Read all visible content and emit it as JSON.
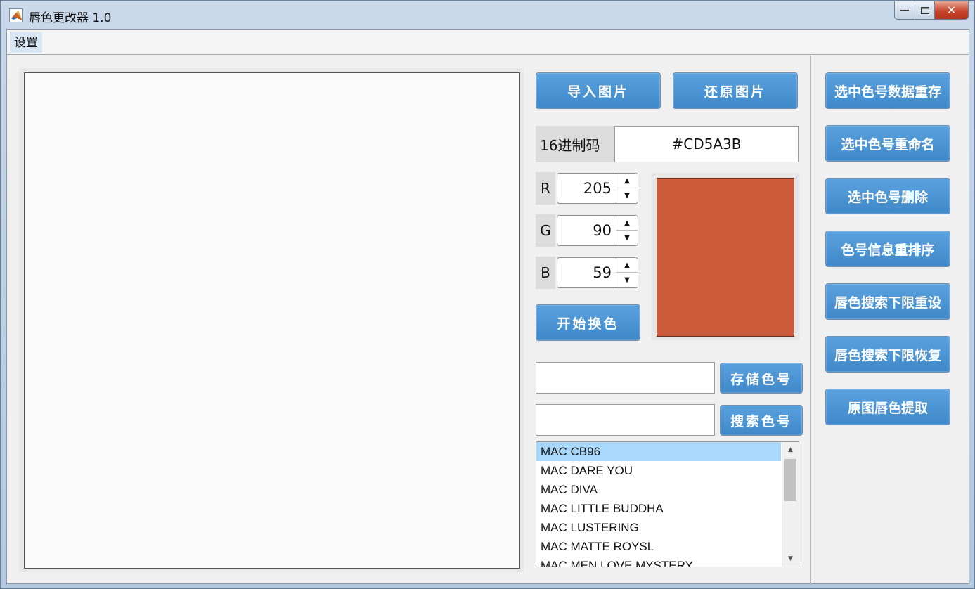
{
  "window": {
    "title": "唇色更改器 1.0"
  },
  "menu": {
    "items": [
      {
        "label": "设置"
      }
    ]
  },
  "buttons": {
    "import_image": "导入图片",
    "restore_image": "还原图片",
    "start_recolor": "开始换色",
    "store_color": "存储色号",
    "search_color": "搜索色号"
  },
  "hex": {
    "label": "16进制码",
    "value": "#CD5A3B"
  },
  "rgb": {
    "r": {
      "label": "R",
      "value": "205"
    },
    "g": {
      "label": "G",
      "value": "90"
    },
    "b": {
      "label": "B",
      "value": "59"
    }
  },
  "swatch": {
    "color": "#CD5A3B"
  },
  "inputs": {
    "store_name": "",
    "search_query": ""
  },
  "color_list": {
    "items": [
      "MAC CB96",
      "MAC DARE YOU",
      "MAC DIVA",
      "MAC LITTLE BUDDHA",
      "MAC LUSTERING",
      "MAC MATTE ROYSL",
      "MAC MEN LOVE MYSTERY"
    ],
    "selected": "MAC CB96"
  },
  "right_panel": {
    "buttons": [
      "选中色号数据重存",
      "选中色号重命名",
      "选中色号删除",
      "色号信息重排序",
      "唇色搜索下限重设",
      "唇色搜索下限恢复",
      "原图唇色提取"
    ]
  },
  "colors": {
    "button_blue": "#4a93d3",
    "list_selection": "#a8d8fb",
    "close_red": "#c8452c"
  }
}
